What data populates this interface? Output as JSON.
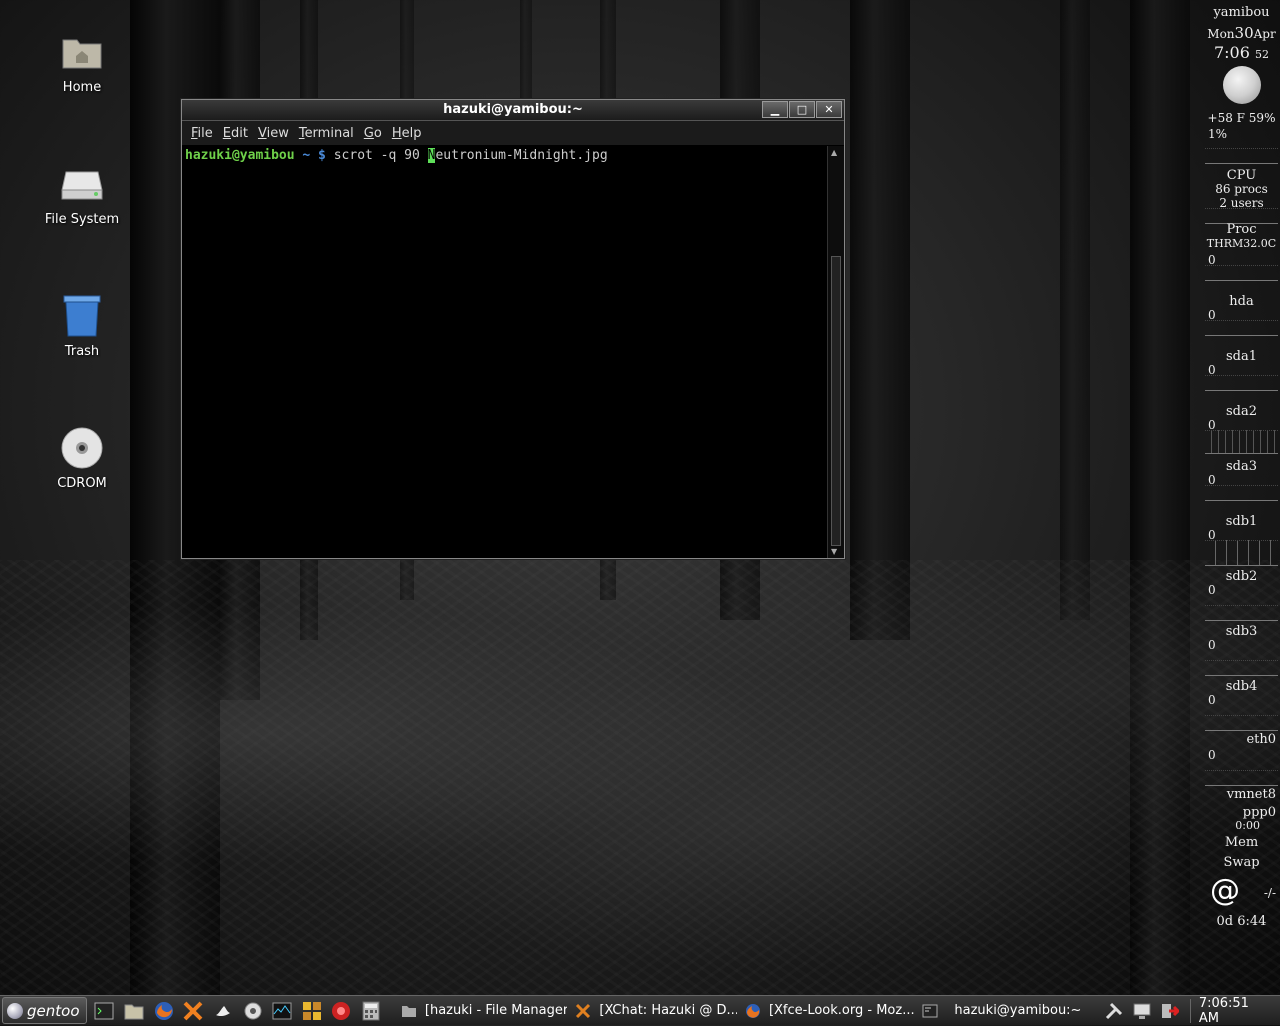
{
  "desktop": {
    "icons": [
      {
        "label": "Home",
        "icon": "home-folder-icon"
      },
      {
        "label": "File System",
        "icon": "drive-icon"
      },
      {
        "label": "Trash",
        "icon": "trash-icon"
      },
      {
        "label": "CDROM",
        "icon": "cdrom-icon"
      }
    ]
  },
  "terminal": {
    "title": "hazuki@yamibou:~",
    "controls": {
      "minimize": "▁",
      "maximize": "□",
      "close": "✕"
    },
    "menu": [
      {
        "key": "F",
        "rest": "ile"
      },
      {
        "key": "E",
        "rest": "dit"
      },
      {
        "key": "V",
        "rest": "iew"
      },
      {
        "key": "T",
        "rest": "erminal"
      },
      {
        "key": "G",
        "rest": "o"
      },
      {
        "key": "H",
        "rest": "elp"
      }
    ],
    "prompt_user": "hazuki@yamibou",
    "prompt_path": "~ $",
    "command_before": "scrot -q 90 ",
    "cursor_char": "N",
    "command_after": "eutronium-Midnight.jpg"
  },
  "conky": {
    "hostname": "yamibou",
    "day": "Mon",
    "date_num": "30",
    "month": "Apr",
    "time": "7:06",
    "seconds": "52",
    "weather": "+58 F 59%",
    "cpu_pct": "1%",
    "cpu_label": "CPU",
    "procs": "86 procs",
    "users": "2 users",
    "proc_label": "Proc",
    "thermal": "THRM32.0C",
    "disks": [
      {
        "value": "0",
        "label": "hda"
      },
      {
        "value": "0",
        "label": "sda1"
      },
      {
        "value": "0",
        "label": "sda2"
      },
      {
        "value": "0",
        "label": "sda3"
      },
      {
        "value": "0",
        "label": "sdb1"
      },
      {
        "value": "0",
        "label": "sdb2"
      },
      {
        "value": "0",
        "label": "sdb3"
      },
      {
        "value": "0",
        "label": "sdb4"
      }
    ],
    "net_first_value": "0",
    "eth": "eth0",
    "eth_value": "0",
    "vmnet": "vmnet8",
    "ppp": "ppp0",
    "ppp_time": "0:00",
    "mem": "Mem",
    "swap": "Swap",
    "mail_count": "-/-",
    "uptime": "0d  6:44"
  },
  "taskbar": {
    "start_label": "gentoo",
    "launchers": [
      "terminal-icon",
      "file-manager-icon",
      "firefox-icon",
      "xchat-icon",
      "pidgin-icon",
      "media-icon",
      "system-monitor-icon",
      "games-icon",
      "dialog-icon",
      "calculator-icon"
    ],
    "tasks": [
      {
        "label": "[hazuki - File Manager]",
        "icon": "folder-icon"
      },
      {
        "label": "[XChat: Hazuki @ D...",
        "icon": "xchat-icon"
      },
      {
        "label": "[Xfce-Look.org - Moz...",
        "icon": "firefox-icon"
      },
      {
        "label": "hazuki@yamibou:~",
        "icon": "terminal-icon"
      }
    ],
    "tray": [
      "tools-icon",
      "network-icon",
      "logout-icon"
    ],
    "clock": "7:06:51 AM"
  }
}
